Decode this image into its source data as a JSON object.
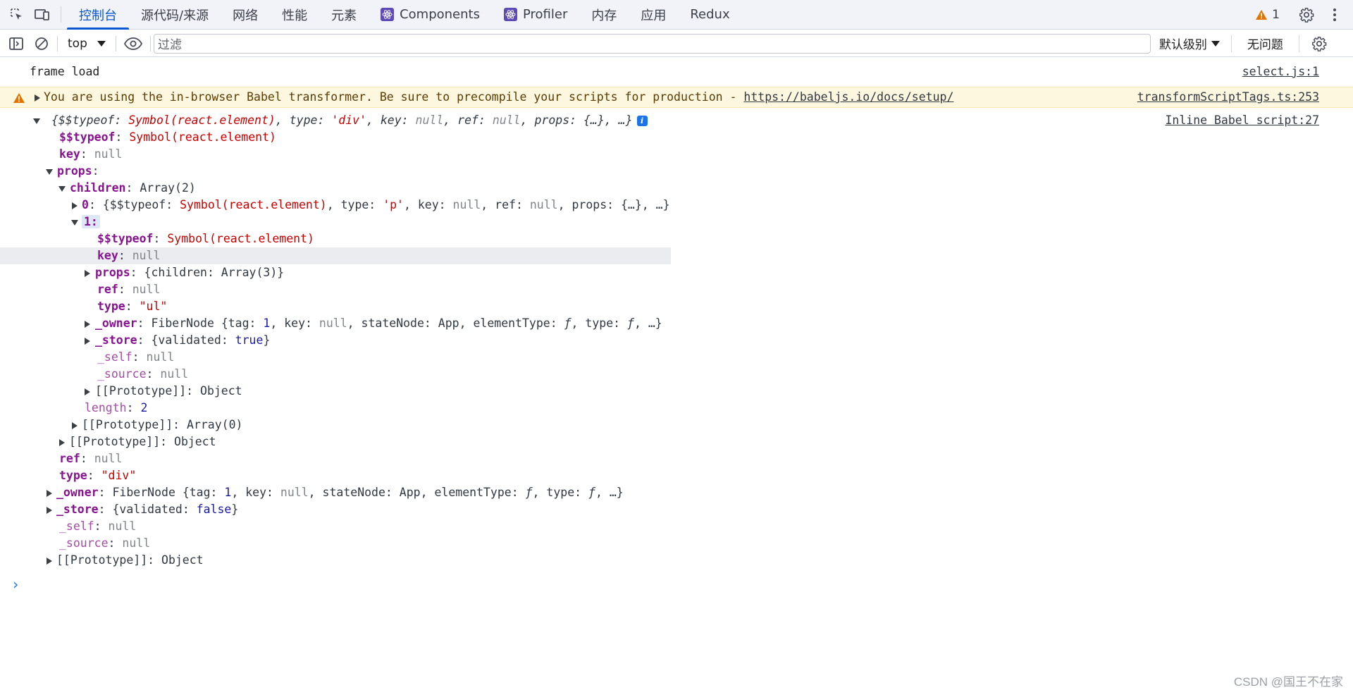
{
  "tabs": [
    {
      "label": "控制台",
      "active": true
    },
    {
      "label": "源代码/来源"
    },
    {
      "label": "网络"
    },
    {
      "label": "性能"
    },
    {
      "label": "元素"
    },
    {
      "label": "Components",
      "react": true
    },
    {
      "label": "Profiler",
      "react": true
    },
    {
      "label": "内存"
    },
    {
      "label": "应用"
    },
    {
      "label": "Redux"
    }
  ],
  "warning_count": "1",
  "toolbar": {
    "context": "top",
    "filter_placeholder": "过滤",
    "level": "默认级别",
    "issues": "无问题"
  },
  "messages": {
    "frame_load": {
      "text": "frame load",
      "source": "select.js:1"
    },
    "babel_warning": {
      "text": "You are using the in-browser Babel transformer. Be sure to precompile your scripts for production - ",
      "link": "https://babeljs.io/docs/setup/",
      "source": "transformScriptTags.ts:253"
    },
    "object_log": {
      "source": "Inline Babel script:27"
    }
  },
  "watermark": "CSDN @国王不在家"
}
